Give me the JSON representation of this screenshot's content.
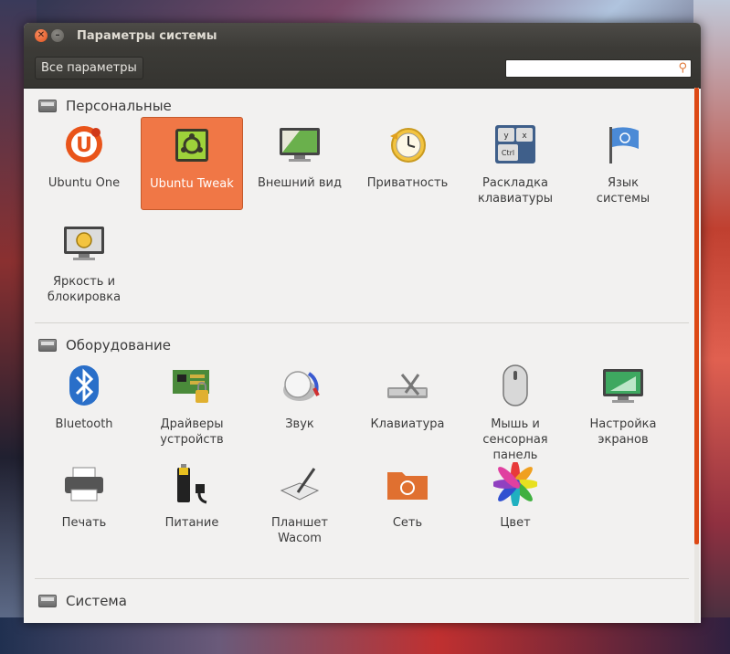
{
  "window": {
    "title": "Параметры системы"
  },
  "toolbar": {
    "all_settings_label": "Все параметры",
    "search_placeholder": ""
  },
  "sections": [
    {
      "title": "Персональные",
      "items": [
        {
          "label": "Ubuntu One",
          "icon": "ubuntu-one-icon"
        },
        {
          "label": "Ubuntu Tweak",
          "icon": "ubuntu-tweak-icon",
          "selected": true
        },
        {
          "label": "Внешний вид",
          "icon": "appearance-icon"
        },
        {
          "label": "Приватность",
          "icon": "privacy-icon"
        },
        {
          "label": "Раскладка\nклавиатуры",
          "icon": "keyboard-layout-icon"
        },
        {
          "label": "Язык\nсистемы",
          "icon": "language-icon"
        },
        {
          "label": "Яркость и\nблокировка",
          "icon": "brightness-lock-icon"
        }
      ]
    },
    {
      "title": "Оборудование",
      "items": [
        {
          "label": "Bluetooth",
          "icon": "bluetooth-icon"
        },
        {
          "label": "Драйверы\nустройств",
          "icon": "drivers-icon"
        },
        {
          "label": "Звук",
          "icon": "sound-icon"
        },
        {
          "label": "Клавиатура",
          "icon": "keyboard-icon"
        },
        {
          "label": "Мышь и\nсенсорная\nпанель",
          "icon": "mouse-icon"
        },
        {
          "label": "Настройка\nэкранов",
          "icon": "displays-icon"
        },
        {
          "label": "Печать",
          "icon": "printer-icon"
        },
        {
          "label": "Питание",
          "icon": "power-icon"
        },
        {
          "label": "Планшет\nWacom",
          "icon": "wacom-tablet-icon"
        },
        {
          "label": "Сеть",
          "icon": "network-icon"
        },
        {
          "label": "Цвет",
          "icon": "color-icon"
        }
      ]
    },
    {
      "title": "Система",
      "items": []
    }
  ],
  "colors": {
    "accent": "#f07746",
    "titlebar": "#3c3b37",
    "background": "#f2f1f0"
  }
}
